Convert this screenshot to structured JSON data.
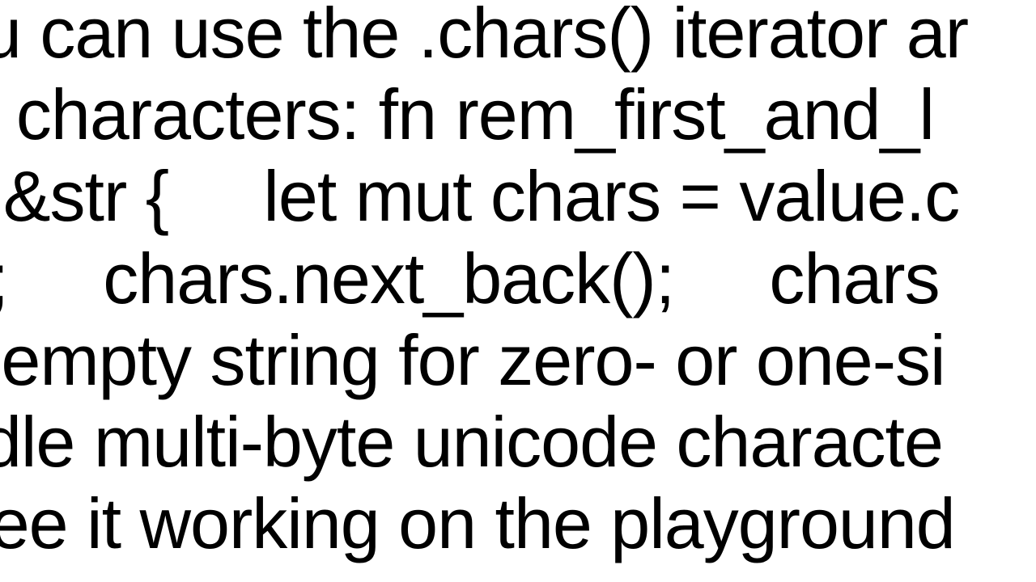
{
  "document": {
    "text": "ou can use the .chars() iterator ar\nst characters: fn rem_first_and_l\n> &str {     let mut chars = value.c\n();     chars.next_back();     chars\nn empty string for zero- or one-si\nndle multi-byte unicode characte\nSee it working on the playground"
  }
}
